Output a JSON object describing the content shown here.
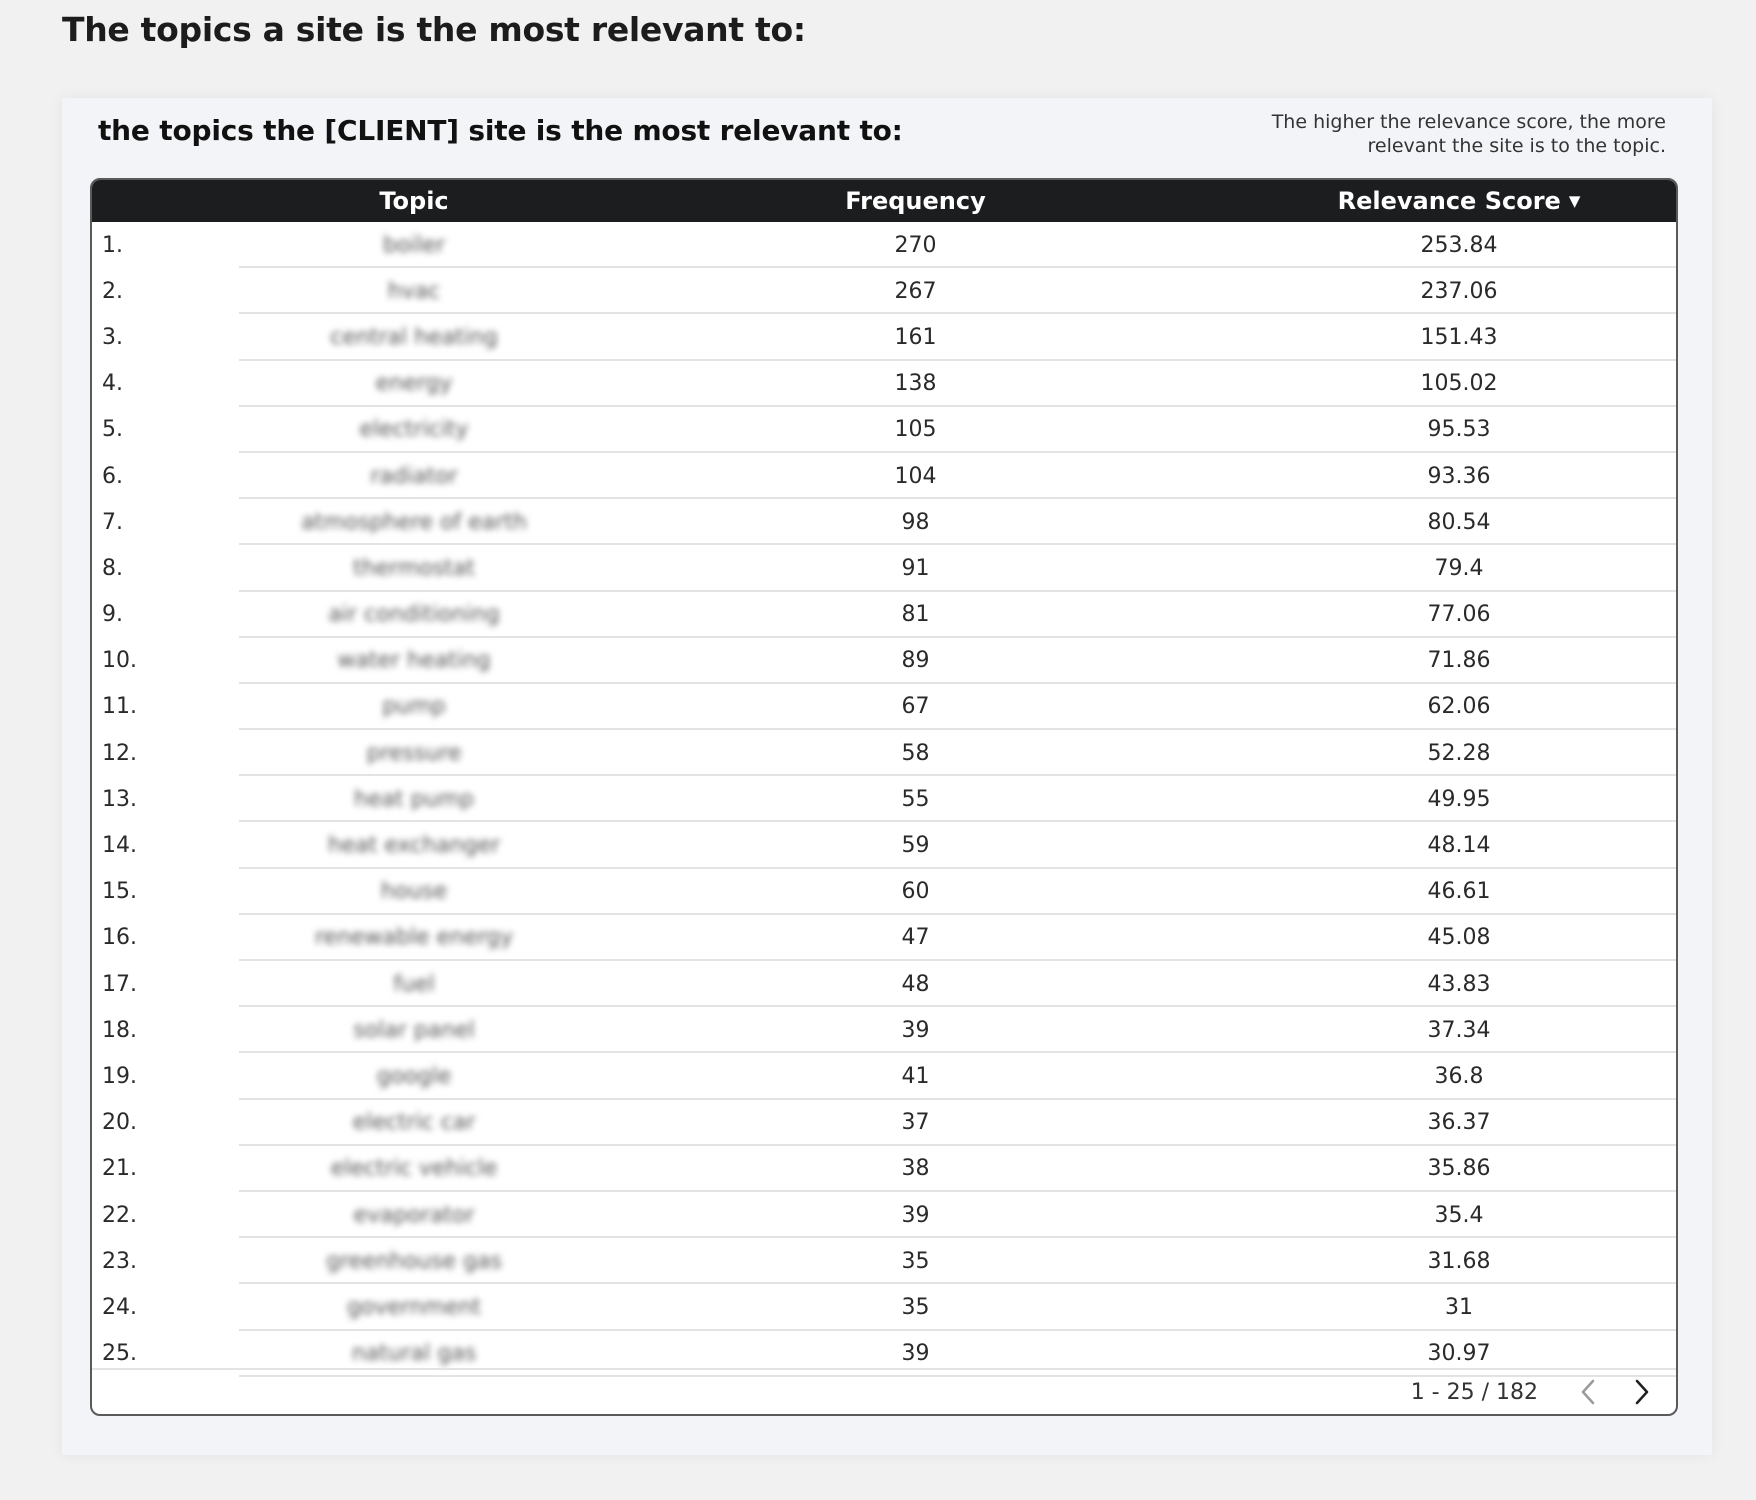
{
  "page": {
    "heading": "The topics a site is the most relevant to:"
  },
  "card": {
    "title": "the topics the [CLIENT] site is the most relevant to:",
    "note": "The higher the relevance score, the more relevant the site is to the topic."
  },
  "table": {
    "columns": {
      "topic": "Topic",
      "frequency": "Frequency",
      "relevance": "Relevance Score",
      "sort_indicator": "▼"
    },
    "rows": [
      {
        "num": "1.",
        "topic": "boiler",
        "frequency": "270",
        "score": "253.84"
      },
      {
        "num": "2.",
        "topic": "hvac",
        "frequency": "267",
        "score": "237.06"
      },
      {
        "num": "3.",
        "topic": "central heating",
        "frequency": "161",
        "score": "151.43"
      },
      {
        "num": "4.",
        "topic": "energy",
        "frequency": "138",
        "score": "105.02"
      },
      {
        "num": "5.",
        "topic": "electricity",
        "frequency": "105",
        "score": "95.53"
      },
      {
        "num": "6.",
        "topic": "radiator",
        "frequency": "104",
        "score": "93.36"
      },
      {
        "num": "7.",
        "topic": "atmosphere of earth",
        "frequency": "98",
        "score": "80.54"
      },
      {
        "num": "8.",
        "topic": "thermostat",
        "frequency": "91",
        "score": "79.4"
      },
      {
        "num": "9.",
        "topic": "air conditioning",
        "frequency": "81",
        "score": "77.06"
      },
      {
        "num": "10.",
        "topic": "water heating",
        "frequency": "89",
        "score": "71.86"
      },
      {
        "num": "11.",
        "topic": "pump",
        "frequency": "67",
        "score": "62.06"
      },
      {
        "num": "12.",
        "topic": "pressure",
        "frequency": "58",
        "score": "52.28"
      },
      {
        "num": "13.",
        "topic": "heat pump",
        "frequency": "55",
        "score": "49.95"
      },
      {
        "num": "14.",
        "topic": "heat exchanger",
        "frequency": "59",
        "score": "48.14"
      },
      {
        "num": "15.",
        "topic": "house",
        "frequency": "60",
        "score": "46.61"
      },
      {
        "num": "16.",
        "topic": "renewable energy",
        "frequency": "47",
        "score": "45.08"
      },
      {
        "num": "17.",
        "topic": "fuel",
        "frequency": "48",
        "score": "43.83"
      },
      {
        "num": "18.",
        "topic": "solar panel",
        "frequency": "39",
        "score": "37.34"
      },
      {
        "num": "19.",
        "topic": "google",
        "frequency": "41",
        "score": "36.8"
      },
      {
        "num": "20.",
        "topic": "electric car",
        "frequency": "37",
        "score": "36.37"
      },
      {
        "num": "21.",
        "topic": "electric vehicle",
        "frequency": "38",
        "score": "35.86"
      },
      {
        "num": "22.",
        "topic": "evaporator",
        "frequency": "39",
        "score": "35.4"
      },
      {
        "num": "23.",
        "topic": "greenhouse gas",
        "frequency": "35",
        "score": "31.68"
      },
      {
        "num": "24.",
        "topic": "government",
        "frequency": "35",
        "score": "31"
      },
      {
        "num": "25.",
        "topic": "natural gas",
        "frequency": "39",
        "score": "30.97"
      }
    ],
    "pagination": {
      "range": "1 - 25 / 182"
    }
  }
}
